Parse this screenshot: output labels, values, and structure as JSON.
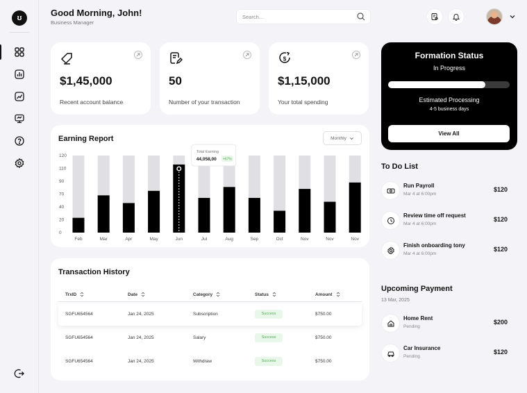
{
  "brand": {
    "logo_text": "ʊ"
  },
  "header": {
    "greeting": "Good Morning, John!",
    "role": "Business Manager",
    "search_placeholder": "Search..."
  },
  "sidebar": {
    "items": [
      {
        "icon": "grid-icon"
      },
      {
        "icon": "bar-chart-icon"
      },
      {
        "icon": "trend-chart-icon"
      },
      {
        "icon": "monitor-icon"
      },
      {
        "icon": "help-icon"
      },
      {
        "icon": "settings-icon"
      }
    ],
    "logout_icon": "logout-icon"
  },
  "stats": [
    {
      "value": "$1,45,000",
      "label": "Recent account balance",
      "icon": "tag-icon"
    },
    {
      "value": "50",
      "label": "Number of your transaction",
      "icon": "document-edit-icon"
    },
    {
      "value": "$1,15,000",
      "label": "Your total spending",
      "icon": "dollar-cycle-icon"
    }
  ],
  "earning_report": {
    "title": "Earning Report",
    "period": "Monthly",
    "tooltip": {
      "label": "Total Earning",
      "value": "44,058,00",
      "change": "+67%"
    }
  },
  "chart_data": {
    "type": "bar",
    "categories": [
      "Feb",
      "Mar",
      "Apr",
      "May",
      "Jun",
      "Jul",
      "Aug",
      "Sep",
      "Oct",
      "Nov",
      "Nov",
      "Nov"
    ],
    "values": [
      23,
      58,
      46,
      65,
      106,
      54,
      71,
      54,
      34,
      68,
      48,
      78
    ],
    "max_values": [
      120,
      120,
      120,
      120,
      120,
      120,
      120,
      120,
      120,
      120,
      120,
      120
    ],
    "yticks": [
      0,
      20,
      40,
      60,
      80,
      100,
      120
    ],
    "ytick_labels": [
      "0",
      "20",
      "40",
      "70",
      "90",
      "110",
      "120"
    ],
    "ylim": [
      0,
      120
    ],
    "highlight_index": 4,
    "colors": {
      "bar": "#000000",
      "track": "#e0e0e4"
    }
  },
  "transactions": {
    "title": "Transaction History",
    "columns": [
      "TrxID",
      "Date",
      "Category",
      "Status",
      "Amount"
    ],
    "rows": [
      {
        "id": "SGFU654564",
        "date": "Jan 24, 2025",
        "category": "Subscription",
        "status": "Success",
        "amount": "$750.00"
      },
      {
        "id": "SGFU654564",
        "date": "Jan 24, 2025",
        "category": "Salary",
        "status": "Success",
        "amount": "$750.00"
      },
      {
        "id": "SGFU654564",
        "date": "Jan 24, 2025",
        "category": "Withdraw",
        "status": "Success",
        "amount": "$750.00"
      }
    ]
  },
  "formation": {
    "title": "Formation Status",
    "status": "In Progress",
    "progress": 0.8,
    "estimated": "Estimated Processing",
    "days": "4-5 business days",
    "button": "View All"
  },
  "todo": {
    "title": "To Do List",
    "items": [
      {
        "title": "Run Payroll",
        "sub": "Mar 4 at 6:00pm",
        "amount": "$120",
        "icon": "money-icon"
      },
      {
        "title": "Review time off request",
        "sub": "Mar 4 at 6:00pm",
        "amount": "$120",
        "icon": "clock-icon"
      },
      {
        "title": "Finish onboarding tony",
        "sub": "Mar 4 at 6:00pm",
        "amount": "$120",
        "icon": "gear-badge-icon"
      }
    ]
  },
  "upcoming": {
    "title": "Upcoming Payment",
    "date": "13 Mar, 2025",
    "items": [
      {
        "title": "Home Rent",
        "sub": "Pending",
        "amount": "$200",
        "icon": "home-icon"
      },
      {
        "title": "Car Insurance",
        "sub": "Pending",
        "amount": "$120",
        "icon": "car-icon"
      }
    ]
  }
}
